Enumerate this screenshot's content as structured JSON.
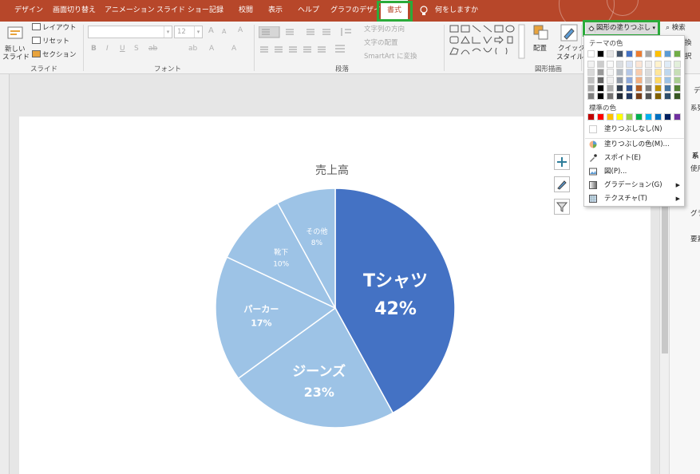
{
  "tabs": [
    "デザイン",
    "画面切り替え",
    "アニメーション",
    "スライド ショー",
    "記録",
    "校閲",
    "表示",
    "ヘルプ",
    "グラフのデザイン",
    "書式"
  ],
  "tell_me": "何をしますか",
  "colors": {
    "accent": "#b7472a",
    "highlight": "#2bab3a",
    "pie_main": "#4472c4",
    "pie_light": "#9dc3e6"
  },
  "ribbon": {
    "slides": {
      "new_slide_1": "新しい",
      "new_slide_2": "スライド",
      "layout": "レイアウト",
      "reset": "リセット",
      "section": "セクション",
      "label": "スライド"
    },
    "font": {
      "size": "12",
      "label": "フォント",
      "bold": "B",
      "italic": "I",
      "underline": "U",
      "strike": "S",
      "spacing": "ab",
      "size_up": "A",
      "size_down": "A",
      "clear": "A",
      "color": "A",
      "highlight": "A"
    },
    "paragraph": {
      "text_direction": "文字列の方向",
      "align_text": "文字の配置",
      "smartart": "SmartArt に変換",
      "label": "段落"
    },
    "drawing": {
      "arrange": "配置",
      "quick_style_1": "クイック",
      "quick_style_2": "スタイル",
      "label": "図形描画"
    },
    "shape_fill": "図形の塗りつぶし",
    "search": "検索",
    "edit_1": "換",
    "edit_2": "択"
  },
  "right_pane": {
    "l1": "データ",
    "l2": "系列の",
    "l3": "系",
    "l4": "使用",
    "l5": "グラ",
    "l6": "要素"
  },
  "chart_data": {
    "type": "pie",
    "title": "売上高",
    "categories": [
      "Tシャツ",
      "ジーンズ",
      "パーカー",
      "靴下",
      "その他"
    ],
    "values": [
      42,
      23,
      17,
      10,
      8
    ],
    "labels": [
      "42%",
      "23%",
      "17%",
      "10%",
      "8%"
    ],
    "legend": "none"
  },
  "menu": {
    "theme_colors": "テーマの色",
    "standard_colors": "標準の色",
    "no_fill": "塗りつぶしなし(N)",
    "more_colors": "塗りつぶしの色(M)...",
    "eyedropper": "スポイト(E)",
    "picture": "図(P)...",
    "gradient": "グラデーション(G)",
    "texture": "テクスチャ(T)",
    "theme_top": [
      "#ffffff",
      "#000000",
      "#e7e6e6",
      "#44546a",
      "#4472c4",
      "#ed7d31",
      "#a5a5a5",
      "#ffc000",
      "#5b9bd5",
      "#70ad47"
    ],
    "standard": [
      "#c00000",
      "#ff0000",
      "#ffc000",
      "#ffff00",
      "#92d050",
      "#00b050",
      "#00b0f0",
      "#0070c0",
      "#002060",
      "#7030a0"
    ]
  }
}
